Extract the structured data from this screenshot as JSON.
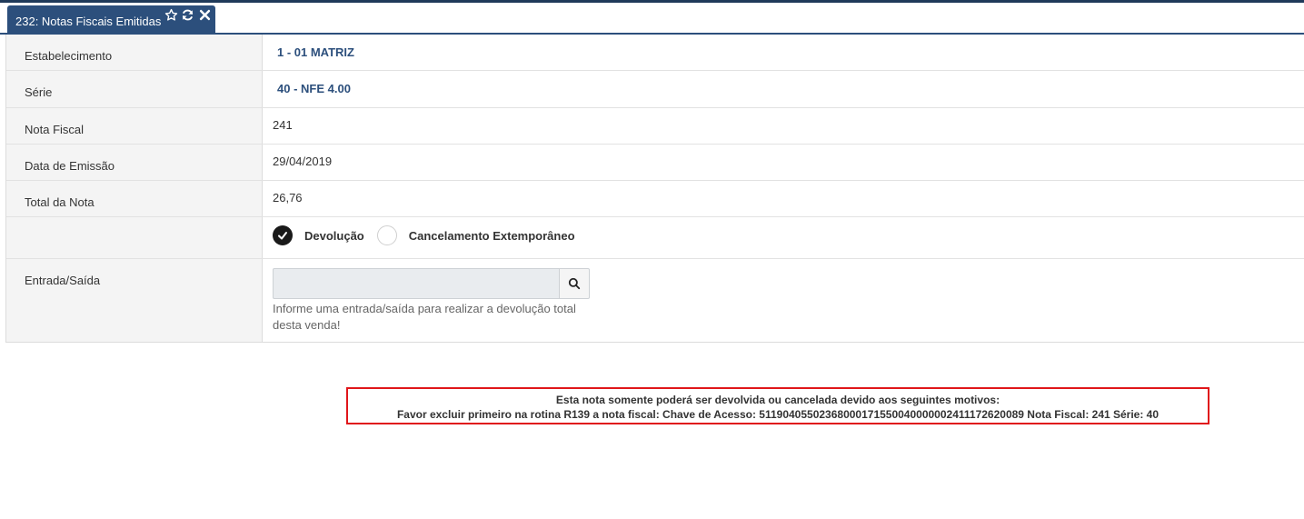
{
  "tab": {
    "title": "232: Notas Fiscais Emitidas",
    "icons": [
      "star-icon",
      "refresh-icon",
      "close-icon"
    ]
  },
  "form": {
    "estabelecimento": {
      "label": "Estabelecimento",
      "value": "1 - 01 MATRIZ"
    },
    "serie": {
      "label": "Série",
      "value": "40 - NFE 4.00"
    },
    "nota_fiscal": {
      "label": "Nota Fiscal",
      "value": "241"
    },
    "data_emissao": {
      "label": "Data de Emissão",
      "value": "29/04/2019"
    },
    "total_nota": {
      "label": "Total da Nota",
      "value": "26,76"
    },
    "options": [
      {
        "label": "Devolução",
        "checked": true
      },
      {
        "label": "Cancelamento Extemporâneo",
        "checked": false
      }
    ],
    "entrada_saida": {
      "label": "Entrada/Saída",
      "value": "",
      "help": "Informe uma entrada/saída para realizar a devolução total desta venda!"
    }
  },
  "alert": {
    "line1": "Esta nota somente poderá ser devolvida ou cancelada devido aos seguintes motivos:",
    "line2": "Favor excluir primeiro na rotina R139 a nota fiscal: Chave de Acesso: 51190405502368000171550040000002411172620089 Nota Fiscal: 241 Série: 40"
  },
  "colors": {
    "header": "#2c4f7c",
    "alert_border": "#e0161a",
    "label_bg": "#f4f4f4",
    "input_bg": "#e9ecef"
  }
}
